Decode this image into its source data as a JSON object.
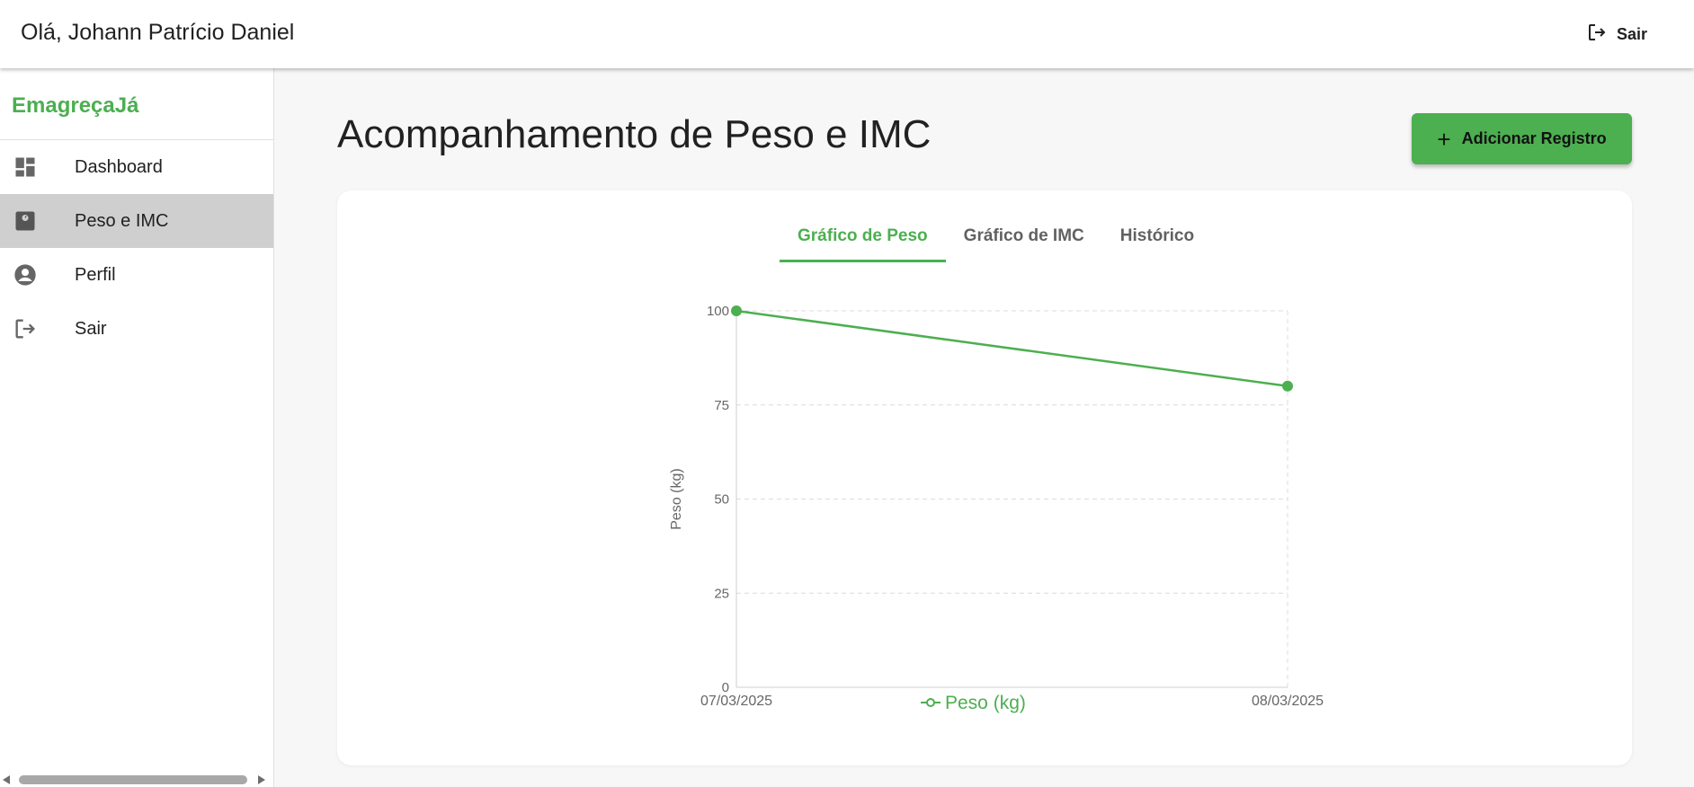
{
  "header": {
    "greeting": "Olá, Johann Patrício Daniel",
    "logout_label": "Sair"
  },
  "sidebar": {
    "brand": "EmagreçaJá",
    "brand_color": "#4caf50",
    "items": [
      {
        "label": "Dashboard",
        "icon": "dashboard-icon",
        "active": false
      },
      {
        "label": "Peso e IMC",
        "icon": "scale-icon",
        "active": true
      },
      {
        "label": "Perfil",
        "icon": "account-circle-icon",
        "active": false
      },
      {
        "label": "Sair",
        "icon": "logout-icon",
        "active": false
      }
    ]
  },
  "main": {
    "title": "Acompanhamento de Peso e IMC",
    "add_button_label": "Adicionar Registro",
    "tabs": [
      {
        "label": "Gráfico de Peso",
        "active": true
      },
      {
        "label": "Gráfico de IMC",
        "active": false
      },
      {
        "label": "Histórico",
        "active": false
      }
    ]
  },
  "chart_data": {
    "type": "line",
    "x": [
      "07/03/2025",
      "08/03/2025"
    ],
    "series": [
      {
        "name": "Peso (kg)",
        "values": [
          100,
          80
        ],
        "color": "#4caf50"
      }
    ],
    "ylabel": "Peso (kg)",
    "ylim": [
      0,
      100
    ],
    "yticks": [
      "0",
      "25",
      "50",
      "75",
      "100"
    ],
    "grid": true,
    "legend_position": "bottom"
  }
}
